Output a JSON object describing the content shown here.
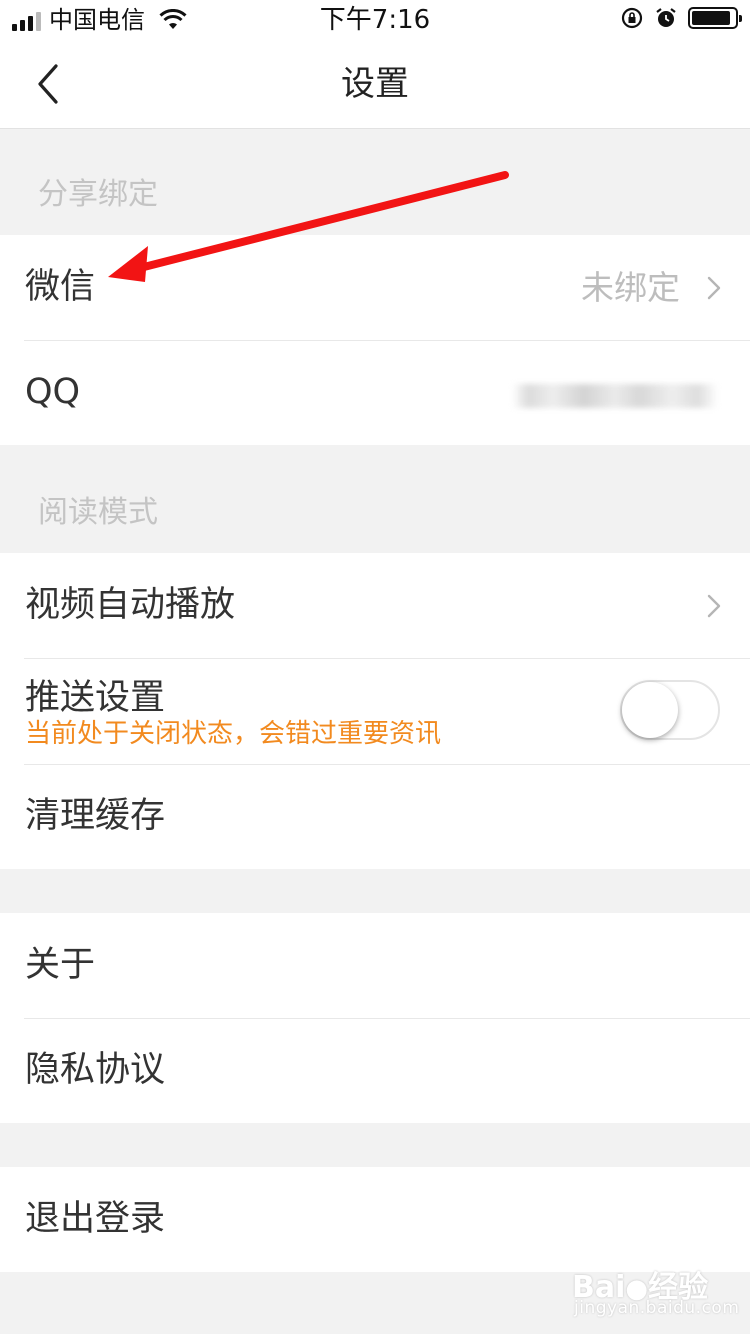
{
  "status_bar": {
    "carrier": "中国电信",
    "time": "下午7:16"
  },
  "nav": {
    "title": "设置"
  },
  "sections": {
    "share_binding": {
      "header": "分享绑定",
      "wechat": {
        "label": "微信",
        "value": "未绑定"
      },
      "qq": {
        "label": "QQ"
      }
    },
    "reading_mode": {
      "header": "阅读模式",
      "video_autoplay": {
        "label": "视频自动播放"
      },
      "push_settings": {
        "label": "推送设置",
        "warning": "当前处于关闭状态，会错过重要资讯",
        "enabled": false
      },
      "clear_cache": {
        "label": "清理缓存"
      }
    },
    "about_group": {
      "about": {
        "label": "关于"
      },
      "privacy": {
        "label": "隐私协议"
      }
    },
    "logout_group": {
      "logout": {
        "label": "退出登录"
      }
    }
  },
  "watermark": {
    "brand": "Bai",
    "brand_cn": "经验",
    "url": "jingyan.baidu.com"
  },
  "colors": {
    "annotation_arrow": "#f21414",
    "warning_text": "#f28a1f"
  }
}
